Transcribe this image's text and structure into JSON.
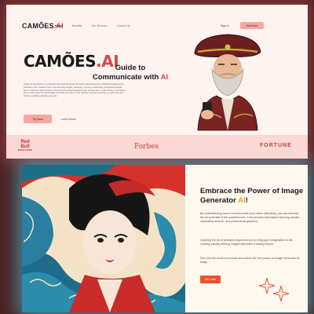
{
  "top_card": {
    "logo": {
      "text": "CAMÕES",
      "ai": ".AI"
    },
    "nav": {
      "links": [
        "Home",
        "Benefits",
        "Our Services",
        "Contact Us"
      ],
      "sign_in": "Sign in",
      "start_btn": "Start Now"
    },
    "hero": {
      "title": "CAMÕES",
      "title_ai": ".AI",
      "sub_line1": "Guide to",
      "sub_line2": "Communicate with",
      "sub_ai": "AI",
      "description": "Image AI Generator is a powerful tool that harnesses the latest advancements in artificial intelligence to transform your creative vision into stunning visuals. However, the key to achieving exceptional results lies in using the right prompts. Choosing the perfect sentence can set the tone. In this course, you'll learn the precise steps and actionable instructions to the AI. Our website will help polishing you with tips and tricks on crafting effective prompts.",
      "try_btn": "Try Now",
      "learn_more": "Learn More"
    },
    "brands": {
      "redbull_1": "Red Bull",
      "redbull_2": "ENERGY DRINK",
      "forbes": "Forbes",
      "fortune": "FORTUNE"
    }
  },
  "bottom_card": {
    "title_line1": "Embrace the Power of Image",
    "title_line2": "Generator",
    "title_ai": "AI",
    "title_end": "!",
    "para1": "By understanding how to communicate your vision effectively, you can harness the full potential of this powerful tool. Craft prompts that inspire stunning visuals, captivating artwork, and professional graphics.",
    "para2": "Learning the art of prompts empowers you to bring your imagination to life, creating visually striking images that leave a lasting impact.",
    "para3": "Dive into the world of prompts and unlock the true power of Image Generator AI today.",
    "join_btn": "Join Now"
  },
  "colors": {
    "background": "#4a1f1f",
    "top_card_bg": "#fff3f0",
    "accent_pink": "#f7a7a2",
    "accent_red": "#d14a4a",
    "accent_orange": "#f09a2a",
    "join_btn": "#e9532f",
    "glow_cyan": "#50dcff"
  },
  "icons": [
    "captain-portrait",
    "geisha-wave-artwork",
    "sparkle-icon",
    "redbull-logo"
  ]
}
